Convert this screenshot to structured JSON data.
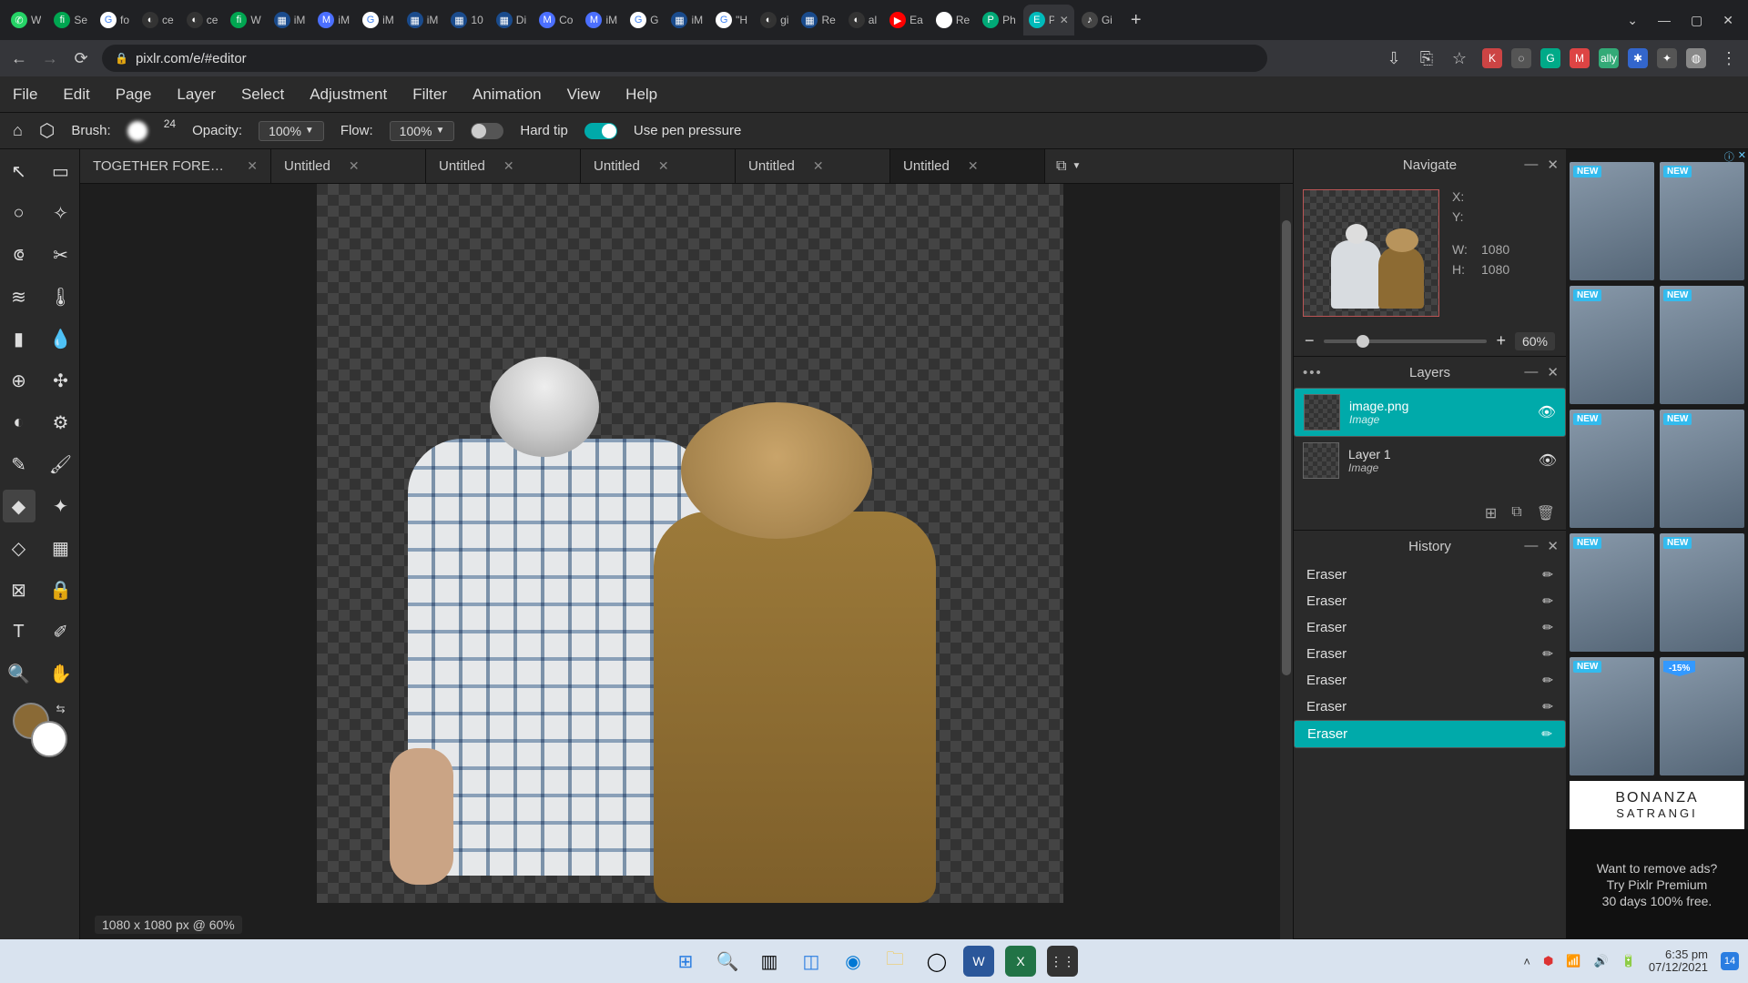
{
  "chrome": {
    "tabs": [
      {
        "fav_bg": "#25D366",
        "fav_txt": "✆",
        "title": "W"
      },
      {
        "fav_bg": "#00a651",
        "fav_txt": "fi",
        "title": "Se"
      },
      {
        "fav_bg": "#fff",
        "fav_txt": "G",
        "title": "fo",
        "fc": "#4285F4"
      },
      {
        "fav_bg": "#333",
        "fav_txt": "◐",
        "title": "ce"
      },
      {
        "fav_bg": "#333",
        "fav_txt": "◐",
        "title": "ce"
      },
      {
        "fav_bg": "#00a651",
        "fav_txt": "fi",
        "title": "W"
      },
      {
        "fav_bg": "#1a4b8c",
        "fav_txt": "▦",
        "title": "iM"
      },
      {
        "fav_bg": "#4b6fff",
        "fav_txt": "M",
        "title": "iM"
      },
      {
        "fav_bg": "#fff",
        "fav_txt": "G",
        "title": "iM",
        "fc": "#4285F4"
      },
      {
        "fav_bg": "#1a4b8c",
        "fav_txt": "▦",
        "title": "iM"
      },
      {
        "fav_bg": "#1a4b8c",
        "fav_txt": "▦",
        "title": "10"
      },
      {
        "fav_bg": "#1a4b8c",
        "fav_txt": "▦",
        "title": "Di"
      },
      {
        "fav_bg": "#4b6fff",
        "fav_txt": "M",
        "title": "Co"
      },
      {
        "fav_bg": "#4b6fff",
        "fav_txt": "M",
        "title": "iM"
      },
      {
        "fav_bg": "#fff",
        "fav_txt": "G",
        "title": "G",
        "fc": "#4285F4"
      },
      {
        "fav_bg": "#1a4b8c",
        "fav_txt": "▦",
        "title": "iM"
      },
      {
        "fav_bg": "#fff",
        "fav_txt": "G",
        "title": "\"H",
        "fc": "#4285F4"
      },
      {
        "fav_bg": "#333",
        "fav_txt": "◐",
        "title": "gi"
      },
      {
        "fav_bg": "#1a4b8c",
        "fav_txt": "▦",
        "title": "Re"
      },
      {
        "fav_bg": "#333",
        "fav_txt": "◐",
        "title": "al"
      },
      {
        "fav_bg": "#f00",
        "fav_txt": "▶",
        "title": "Ea"
      },
      {
        "fav_bg": "#fff",
        "fav_txt": "·",
        "title": "Re"
      },
      {
        "fav_bg": "#0a7",
        "fav_txt": "P",
        "title": "Ph"
      },
      {
        "fav_bg": "#0bb",
        "fav_txt": "E",
        "title": "Pi",
        "active": true
      },
      {
        "fav_bg": "#444",
        "fav_txt": "♪",
        "title": "Gi"
      }
    ],
    "url": "pixlr.com/e/#editor",
    "ext_badges": [
      "⇩",
      "⎘",
      "☆"
    ],
    "ext_icons": [
      {
        "bg": "#c44",
        "txt": "K"
      },
      {
        "bg": "#555",
        "txt": "◌"
      },
      {
        "bg": "#0a8",
        "txt": "G"
      },
      {
        "bg": "#d44",
        "txt": "M"
      },
      {
        "bg": "#3a7",
        "txt": "ally"
      },
      {
        "bg": "#36c",
        "txt": "✱"
      },
      {
        "bg": "#555",
        "txt": "✦"
      },
      {
        "bg": "#888",
        "txt": "◍"
      }
    ]
  },
  "menu": [
    "File",
    "Edit",
    "Page",
    "Layer",
    "Select",
    "Adjustment",
    "Filter",
    "Animation",
    "View",
    "Help"
  ],
  "options": {
    "brush_label": "Brush:",
    "brush_size": "24",
    "opacity_label": "Opacity:",
    "opacity_val": "100%",
    "flow_label": "Flow:",
    "flow_val": "100%",
    "hard_tip": "Hard tip",
    "pen_pressure": "Use pen pressure"
  },
  "doc_tabs": [
    {
      "title": "TOGETHER FOREV..."
    },
    {
      "title": "Untitled"
    },
    {
      "title": "Untitled"
    },
    {
      "title": "Untitled"
    },
    {
      "title": "Untitled"
    },
    {
      "title": "Untitled",
      "active": true
    }
  ],
  "tools": [
    "↖",
    "▭",
    "○",
    "✧",
    "⟃",
    "✂",
    "≋",
    "🌡",
    "▮",
    "💧",
    "⊕",
    "✣",
    "◐",
    "⚙",
    "✎",
    "🖌",
    "◆",
    "✦",
    "◇",
    "▦",
    "⊠",
    "🔒",
    "T",
    "✐",
    "🔍",
    "✋"
  ],
  "colors": {
    "fg": "#8a6a36",
    "bg": "#ffffff"
  },
  "status": "1080 x 1080 px @ 60%",
  "navigate": {
    "title": "Navigate",
    "x_label": "X:",
    "x_val": "",
    "y_label": "Y:",
    "y_val": "",
    "w_label": "W:",
    "w_val": "1080",
    "h_label": "H:",
    "h_val": "1080",
    "zoom": "60%"
  },
  "layers": {
    "title": "Layers",
    "items": [
      {
        "name": "image.png",
        "type": "Image",
        "selected": true
      },
      {
        "name": "Layer 1",
        "type": "Image",
        "selected": false
      }
    ]
  },
  "history": {
    "title": "History",
    "items": [
      "Eraser",
      "Eraser",
      "Eraser",
      "Eraser",
      "Eraser",
      "Eraser",
      "Eraser"
    ]
  },
  "ads": {
    "badges": [
      "NEW",
      "NEW",
      "NEW",
      "NEW",
      "NEW",
      "NEW",
      "NEW",
      "NEW",
      "NEW",
      "-15%"
    ],
    "brand_line1": "BONANZA",
    "brand_line2": "SATRANGI",
    "footer": [
      "Want to remove ads?",
      "Try Pixlr Premium",
      "30 days 100% free."
    ]
  },
  "taskbar": {
    "time": "6:35 pm",
    "date": "07/12/2021",
    "notif": "14"
  }
}
